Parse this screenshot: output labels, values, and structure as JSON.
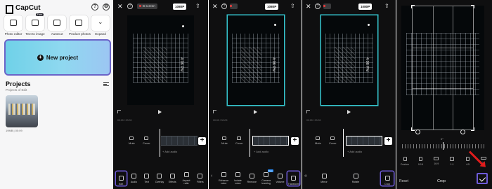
{
  "home": {
    "app_name": "CapCut",
    "tools": [
      {
        "label": "Photo editor",
        "icon": "photo-editor-icon",
        "badge": ""
      },
      {
        "label": "Text to image",
        "icon": "text-to-image-icon",
        "badge": "Free"
      },
      {
        "label": "AutoCut",
        "icon": "autocut-icon",
        "badge": ""
      },
      {
        "label": "Product photos",
        "icon": "product-photos-icon",
        "badge": ""
      },
      {
        "label": "Expand",
        "icon": "chevron-down-icon",
        "badge": ""
      }
    ],
    "new_project_label": "New project",
    "projects_title": "Projects",
    "projects_subtitle": "Projects of Edit",
    "thumb_meta": "19MB | 00:09"
  },
  "editor": {
    "resolution": "1080P",
    "source_label": "B screen",
    "video_time": "4:06 PM",
    "timestamps": "00:00 / 00:09",
    "mute_label": "Mute",
    "cover_label": "Cover",
    "add_audio_label": "+ Add audio",
    "toolbar_main": [
      "Edit",
      "Audio",
      "Text",
      "Overlay",
      "Effects",
      "Aspect ratio",
      "Filters"
    ],
    "toolbar_edit": [
      "Enhance voice",
      "Isolate voice",
      "Remove",
      "Camera tracking",
      "Volume",
      "Transform"
    ],
    "new_badge": "New",
    "toolbar_transform": [
      "Mirror",
      "Rotate",
      "Crop"
    ]
  },
  "crop": {
    "degree_label": "0°",
    "ratios": [
      "Custom",
      "9:16",
      "16:9",
      "1:1",
      "4:5",
      "2:1"
    ],
    "reset_label": "Reset",
    "title": "Crop"
  },
  "colors": {
    "highlight": "#6e5bd8",
    "arrow": "#e01c1c",
    "selection_teal": "#35c6cf"
  }
}
